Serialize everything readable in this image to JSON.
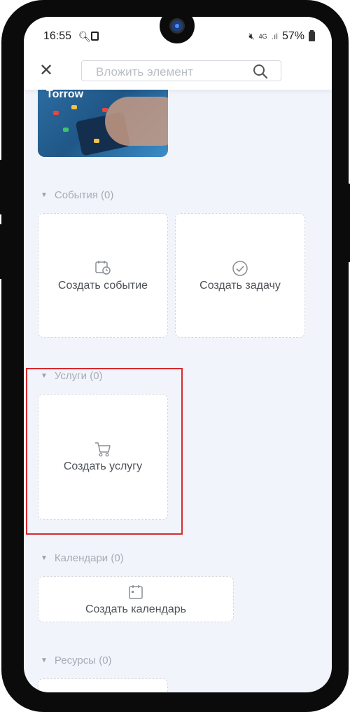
{
  "status_bar": {
    "time": "16:55",
    "network": "4G",
    "battery": "57%"
  },
  "header": {
    "close_label": "✕",
    "search_placeholder": "Вложить элемент"
  },
  "thumbnail": {
    "caption": "Torrow"
  },
  "sections": {
    "events": {
      "title": "События (0)",
      "create_event": "Создать событие",
      "create_task": "Создать задачу"
    },
    "services": {
      "title": "Услуги (0)",
      "create_service": "Создать услугу"
    },
    "calendars": {
      "title": "Календари (0)",
      "create_calendar": "Создать календарь"
    },
    "resources": {
      "title": "Ресурсы (0)"
    }
  },
  "colors": {
    "highlight": "#d9292f",
    "screen_bg": "#f1f4fa",
    "muted_text": "#a6acb6"
  }
}
